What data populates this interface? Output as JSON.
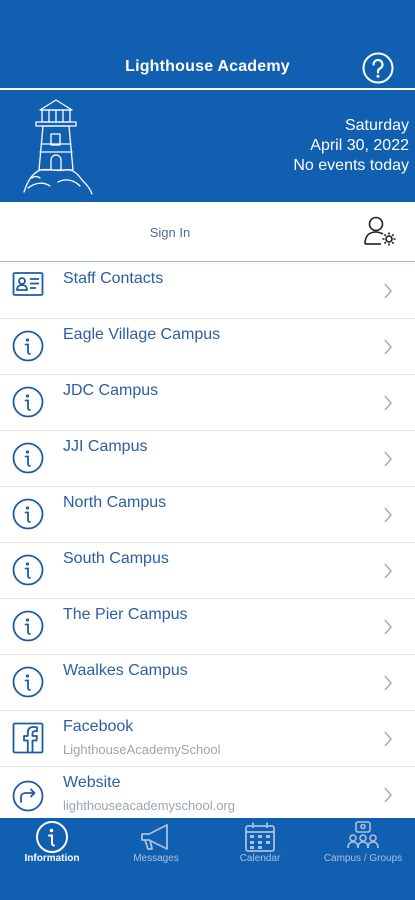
{
  "header": {
    "title": "Lighthouse Academy",
    "help_icon": "question-circle-icon"
  },
  "banner": {
    "day": "Saturday",
    "date": "April 30, 2022",
    "events": "No events today",
    "logo_icon": "lighthouse-logo"
  },
  "signin": {
    "label": "Sign In",
    "icon": "user-settings-icon"
  },
  "list": {
    "items": [
      {
        "label": "Staff Contacts",
        "icon": "contact-card-icon"
      },
      {
        "label": "Eagle Village Campus",
        "icon": "info-circle-icon"
      },
      {
        "label": "JDC Campus",
        "icon": "info-circle-icon"
      },
      {
        "label": "JJI Campus",
        "icon": "info-circle-icon"
      },
      {
        "label": "North Campus",
        "icon": "info-circle-icon"
      },
      {
        "label": "South Campus",
        "icon": "info-circle-icon"
      },
      {
        "label": "The Pier Campus",
        "icon": "info-circle-icon"
      },
      {
        "label": "Waalkes Campus",
        "icon": "info-circle-icon"
      },
      {
        "label": "Facebook",
        "sub": "LighthouseAcademySchool",
        "icon": "facebook-icon"
      },
      {
        "label": "Website",
        "sub": "lighthouseacademyschool.org",
        "icon": "website-icon"
      }
    ]
  },
  "tabs": [
    {
      "label": "Information",
      "icon": "info-circle-icon",
      "active": true
    },
    {
      "label": "Messages",
      "icon": "megaphone-icon",
      "active": false
    },
    {
      "label": "Calendar",
      "icon": "calendar-icon",
      "active": false
    },
    {
      "label": "Campus / Groups",
      "icon": "groups-icon",
      "active": false
    }
  ],
  "colors": {
    "brand_blue": "#115fb1",
    "text_blue": "#2b5ea3",
    "muted_gray": "#9aa5b1",
    "tab_inactive": "#a8c0de"
  }
}
